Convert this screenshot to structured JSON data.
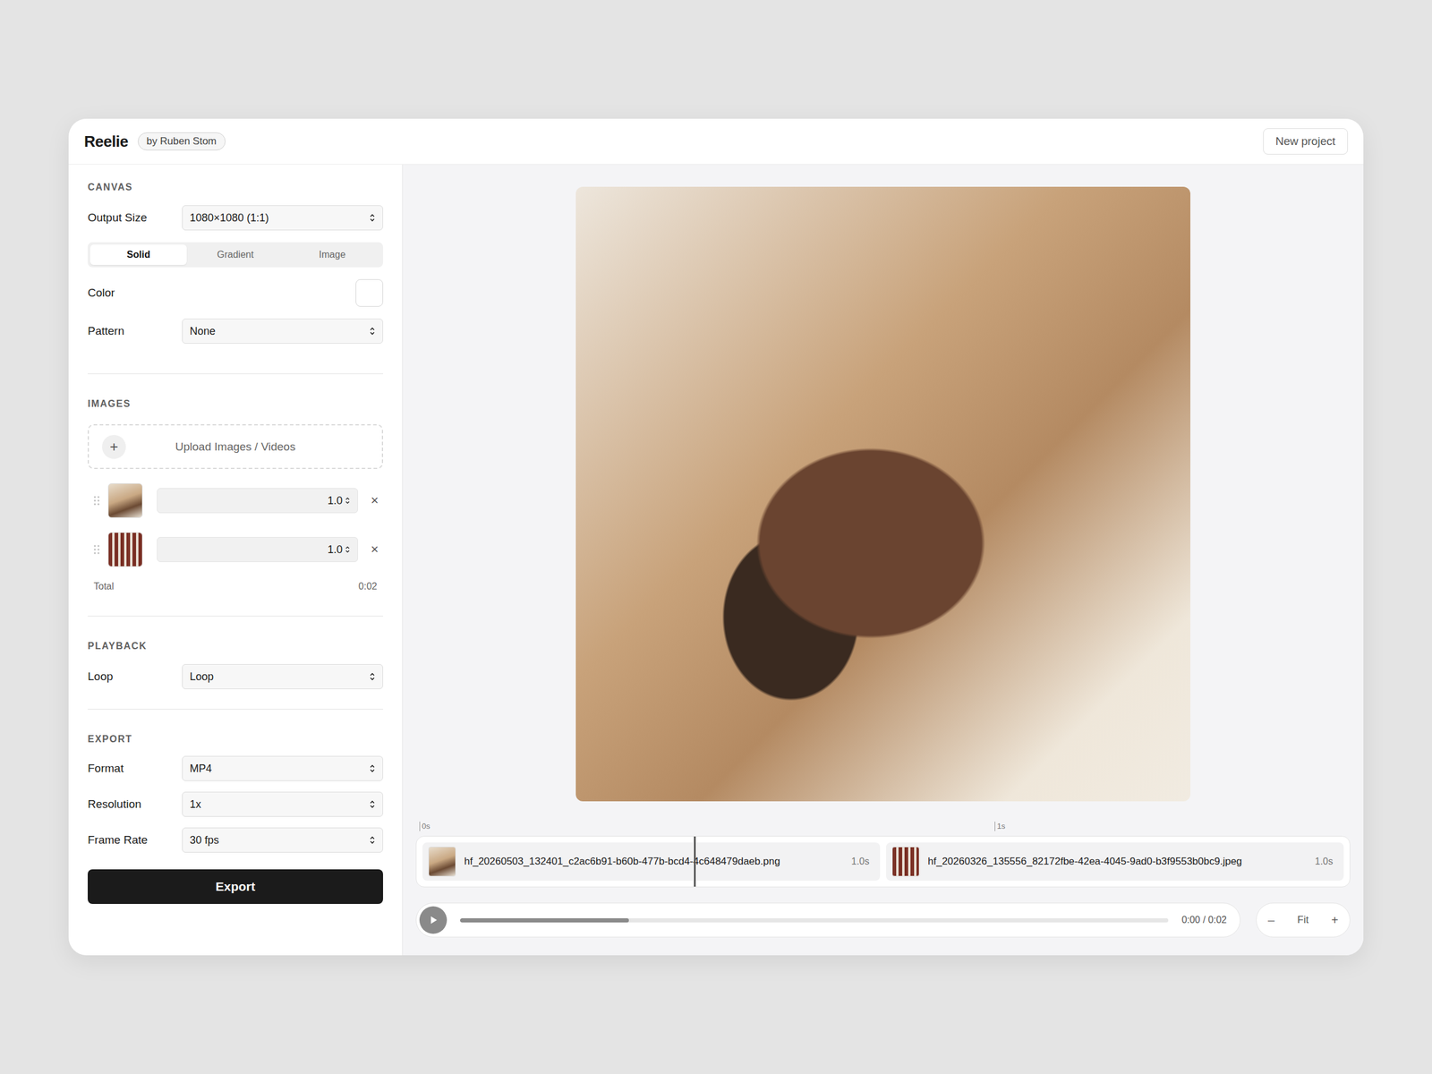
{
  "app": {
    "title": "Reelie",
    "badge": "by Ruben Stom",
    "new_project": "New project"
  },
  "canvas": {
    "heading": "CANVAS",
    "output_size": {
      "label": "Output Size",
      "value": "1080×1080 (1:1)"
    },
    "fill_tabs": [
      {
        "label": "Solid",
        "selected": true
      },
      {
        "label": "Gradient",
        "selected": false
      },
      {
        "label": "Image",
        "selected": false
      }
    ],
    "color": {
      "label": "Color",
      "value": "#ffffff"
    },
    "pattern": {
      "label": "Pattern",
      "value": "None"
    }
  },
  "images": {
    "heading": "IMAGES",
    "upload": {
      "icon": "+",
      "label": "Upload Images / Videos"
    },
    "items": [
      {
        "duration": "1.0",
        "remove": "×"
      },
      {
        "duration": "1.0",
        "remove": "×"
      }
    ],
    "total": {
      "label": "Total",
      "value": "0:02"
    }
  },
  "playback": {
    "heading": "PLAYBACK",
    "loop": {
      "label": "Loop",
      "value": "Loop"
    }
  },
  "export": {
    "heading": "EXPORT",
    "fields": [
      {
        "label": "Format",
        "value": "MP4"
      },
      {
        "label": "Resolution",
        "value": "1x"
      },
      {
        "label": "Frame Rate",
        "value": "30 fps"
      }
    ],
    "button": "Export"
  },
  "timeline": {
    "ticks": [
      "0s",
      "1s"
    ],
    "clips": [
      {
        "name": "hf_20260503_132401_c2ac6b91-b60b-477b-bcd4-4c648479daeb.png",
        "duration": "1.0s"
      },
      {
        "name": "hf_20260326_135556_82172fbe-42ea-4045-9ad0-b3f9553b0bc9.jpeg",
        "duration": "1.0s"
      }
    ],
    "playhead": 0.295
  },
  "player": {
    "playing": false,
    "progress": 0.238,
    "time": "0:00 / 0:02"
  },
  "zoom": {
    "out": "–",
    "fit": "Fit",
    "in": "+"
  }
}
